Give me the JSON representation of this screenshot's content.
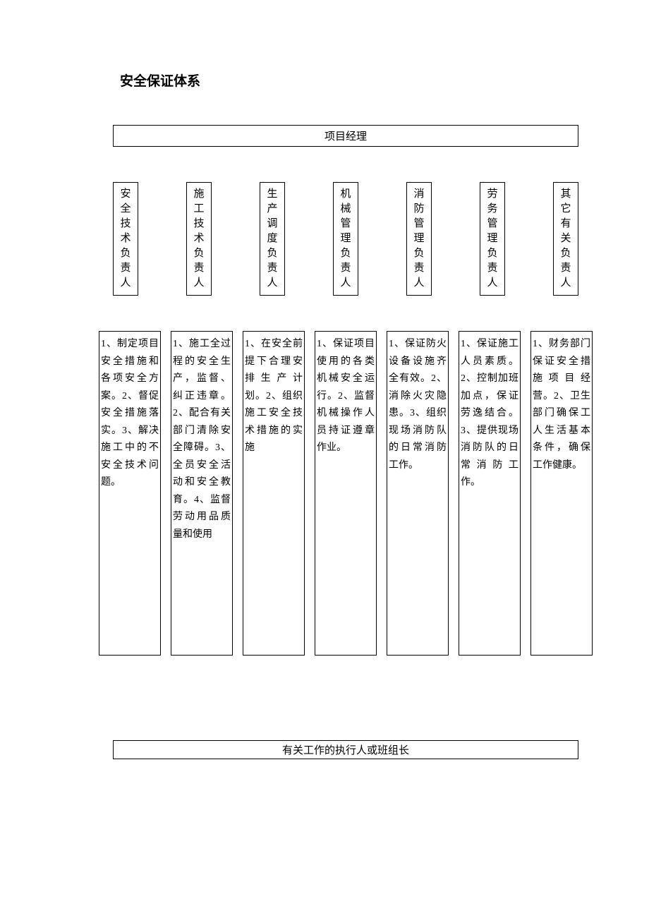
{
  "title": "安全保证体系",
  "topBox": "项目经理",
  "roles": [
    "安全技术负责人",
    "施工技术负责人",
    "生产调度负责人",
    "机械管理负责人",
    "消防管理负责人",
    "劳务管理负责人",
    "其它有关负责人"
  ],
  "descriptions": [
    "1、制定项目安全措施和各项安全方案。2、督促安全措施落实。3、解决施工中的不安全技术问题。",
    "1、施工全过程的安全生产，监督、纠正违章。2、配合有关部门清除安全障碍。3、全员安全活动和安全教育。4、监督劳动用品质量和使用",
    "1、在安全前提下合理安排生产计划。2、组织施工安全技术措施的实施",
    "1、保证项目使用的各类机械安全运行。2、监督机械操作人员持证遵章作业。",
    "1、保证防火设备设施齐全有效。2、消除火灾隐患。3、组织现场消防队的日常消防工作。",
    "1、保证施工人员素质。2、控制加班加点，保证劳逸结合。3、提供现场消防队的日常消防工作。",
    "1、财务部门保证安全措施项目经营。2、卫生部门确保工人生活基本条件，确保工作健康。"
  ],
  "bottomBox": "有关工作的执行人或班组长"
}
